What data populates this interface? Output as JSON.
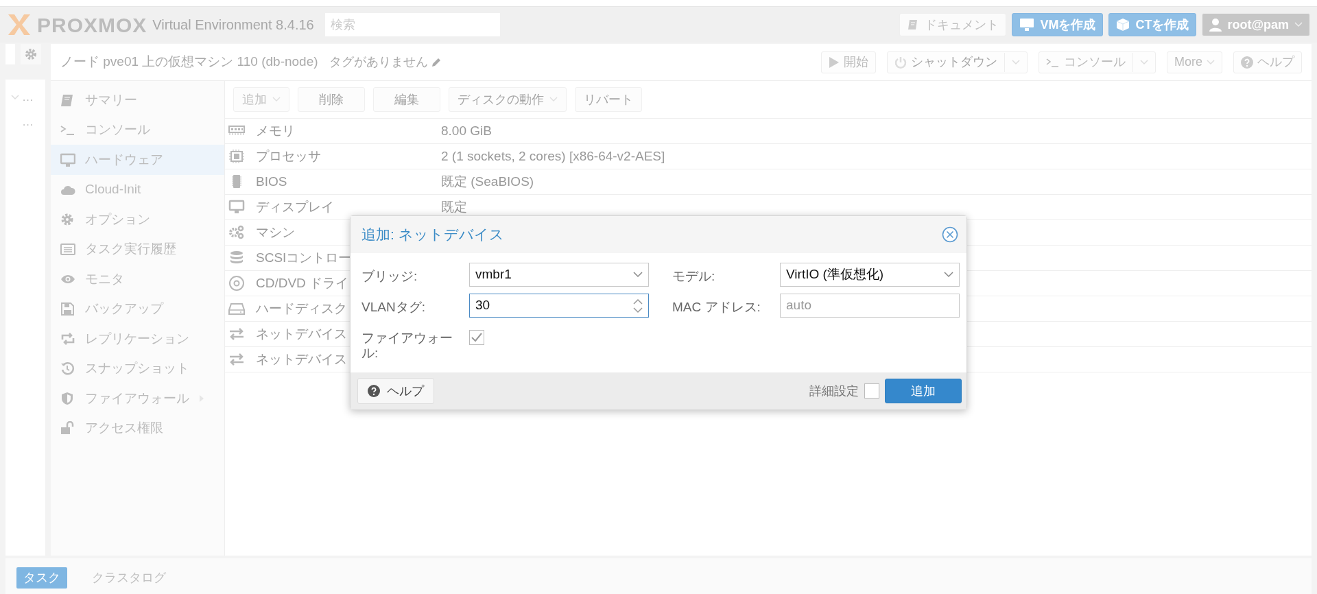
{
  "header": {
    "logo": "PROXMOX",
    "product": "Virtual Environment 8.4.16",
    "search": {
      "placeholder": "検索"
    },
    "buttons": [
      {
        "label": "ドキュメント",
        "kind": "plain"
      },
      {
        "label": "VMを作成",
        "kind": "primary"
      },
      {
        "label": "CTを作成",
        "kind": "primary"
      },
      {
        "label": "root@pam",
        "kind": "user"
      }
    ]
  },
  "tree": {
    "items": [
      {
        "label": "…",
        "expanded": true
      },
      {
        "label": "…",
        "expanded": false
      }
    ]
  },
  "title": "ノード pve01 上の仮想マシン 110 (db-node)",
  "tags": "タグがありません",
  "actions": [
    {
      "label": "開始",
      "split": false,
      "dropdown": false,
      "disabled": false
    },
    {
      "label": "シャットダウン",
      "split": true,
      "dropdown": true,
      "disabled": true
    },
    {
      "label": "コンソール",
      "split": true,
      "dropdown": true,
      "disabled": false
    },
    {
      "label": "More",
      "split": false,
      "dropdown": true,
      "disabled": false
    },
    {
      "label": "ヘルプ",
      "split": false,
      "dropdown": false,
      "disabled": false
    }
  ],
  "menu": [
    {
      "label": "サマリー",
      "selected": false,
      "has_submenu": false
    },
    {
      "label": "コンソール",
      "selected": false,
      "has_submenu": false
    },
    {
      "label": "ハードウェア",
      "selected": true,
      "has_submenu": false
    },
    {
      "label": "Cloud-Init",
      "selected": false,
      "has_submenu": false
    },
    {
      "label": "オプション",
      "selected": false,
      "has_submenu": false
    },
    {
      "label": "タスク実行履歴",
      "selected": false,
      "has_submenu": false
    },
    {
      "label": "モニタ",
      "selected": false,
      "has_submenu": false
    },
    {
      "label": "バックアップ",
      "selected": false,
      "has_submenu": false
    },
    {
      "label": "レプリケーション",
      "selected": false,
      "has_submenu": false
    },
    {
      "label": "スナップショット",
      "selected": false,
      "has_submenu": false
    },
    {
      "label": "ファイアウォール",
      "selected": false,
      "has_submenu": true
    },
    {
      "label": "アクセス権限",
      "selected": false,
      "has_submenu": false
    }
  ],
  "toolbar": [
    {
      "label": "追加",
      "dropdown": true,
      "disabled": false
    },
    {
      "label": "削除",
      "dropdown": false,
      "disabled": true
    },
    {
      "label": "編集",
      "dropdown": false,
      "disabled": true
    },
    {
      "label": "ディスクの動作",
      "dropdown": true,
      "disabled": true
    },
    {
      "label": "リバート",
      "dropdown": false,
      "disabled": true
    }
  ],
  "hardware": [
    {
      "name": "メモリ",
      "value": "8.00 GiB"
    },
    {
      "name": "プロセッサ",
      "value": "2 (1 sockets, 2 cores) [x86-64-v2-AES]"
    },
    {
      "name": "BIOS",
      "value": "既定 (SeaBIOS)"
    },
    {
      "name": "ディスプレイ",
      "value": "既定"
    },
    {
      "name": "マシン"
    },
    {
      "name": "SCSIコントロー"
    },
    {
      "name": "CD/DVD ドライ"
    },
    {
      "name": "ハードディスク"
    },
    {
      "name": "ネットデバイス"
    },
    {
      "name": "ネットデバイス"
    }
  ],
  "dialog": {
    "title": "追加: ネットデバイス",
    "left": [
      {
        "label": "ブリッジ:",
        "kind": "select",
        "value": "vmbr1",
        "focused": false
      },
      {
        "label": "VLANタグ:",
        "kind": "number",
        "value": "30",
        "focused": true
      },
      {
        "label": "ファイアウォール:",
        "kind": "checkbox",
        "checked": true
      }
    ],
    "right": [
      {
        "label": "モデル:",
        "kind": "select",
        "value": "VirtIO (準仮想化)",
        "focused": false
      },
      {
        "label": "MAC アドレス:",
        "kind": "text",
        "placeholder": "auto",
        "focused": false
      }
    ],
    "help": "ヘルプ",
    "advanced": {
      "label": "詳細設定",
      "checked": false
    },
    "submit": "追加"
  },
  "bottom_tabs": [
    {
      "label": "タスク",
      "selected": true
    },
    {
      "label": "クラスタログ",
      "selected": false
    }
  ]
}
